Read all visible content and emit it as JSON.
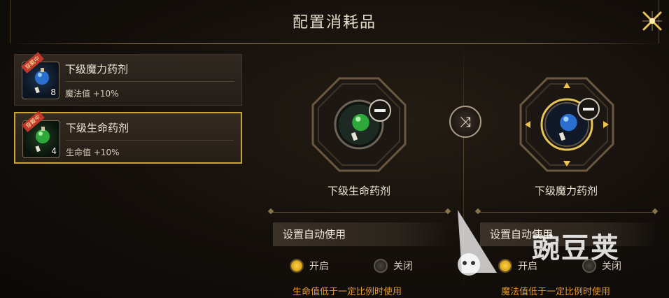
{
  "title": "配置消耗品",
  "items": [
    {
      "name": "下级魔力药剂",
      "effect": "魔法值 +10%",
      "qty": "8",
      "tag": "穿戴中",
      "potion_color": "#2a6fd0"
    },
    {
      "name": "下级生命药剂",
      "effect": "生命值 +10%",
      "qty": "4",
      "tag": "穿戴中",
      "potion_color": "#2fa83a"
    }
  ],
  "slots": [
    {
      "name": "下级生命药剂",
      "auto_use_label": "设置自动使用",
      "option_on": "开启",
      "option_off": "关闭",
      "state": "on",
      "hint": "生命值低于一定比例时使用"
    },
    {
      "name": "下级魔力药剂",
      "auto_use_label": "设置自动使用",
      "option_on": "开启",
      "option_off": "关闭",
      "state": "on",
      "hint": "魔法值低于一定比例时使用"
    }
  ],
  "watermark": "豌豆荚",
  "colors": {
    "accent_gold": "#c9a43c",
    "hint_orange": "#e89a2a"
  }
}
